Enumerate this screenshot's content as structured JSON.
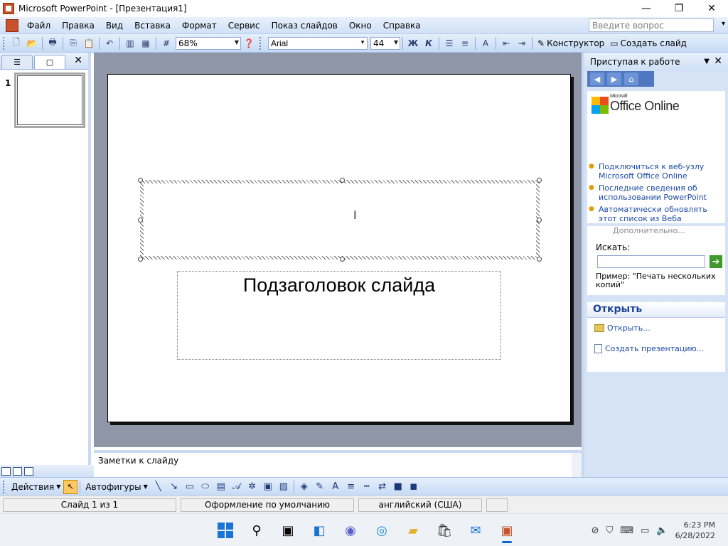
{
  "window": {
    "title": "Microsoft PowerPoint - [Презентация1]",
    "minimize": "—",
    "maximize": "❐",
    "close": "✕"
  },
  "menu": {
    "items": [
      "Файл",
      "Правка",
      "Вид",
      "Вставка",
      "Формат",
      "Сервис",
      "Показ слайдов",
      "Окно",
      "Справка"
    ],
    "help_placeholder": "Введите вопрос"
  },
  "toolbar": {
    "zoom": "68%",
    "font": "Arial",
    "font_size": "44",
    "bold_label": "Ж",
    "italic_label": "К",
    "designer_label": "Конструктор",
    "new_slide_label": "Создать слайд"
  },
  "left_pane": {
    "slide_number": "1"
  },
  "slide": {
    "subtitle_placeholder": "Подзаголовок слайда"
  },
  "notes": {
    "placeholder": "Заметки к слайду"
  },
  "task_pane": {
    "title": "Приступая к работе",
    "office_logo_small": "Microsoft",
    "office_logo_text": "Office Online",
    "links": [
      "Подключиться к веб-узлу Microsoft Office Online",
      "Последние сведения об использовании PowerPoint",
      "Автоматически обновлять этот список из Веба"
    ],
    "more": "Дополнительно...",
    "search_label": "Искать:",
    "example": "Пример: \"Печать нескольких копий\"",
    "open_section_title": "Открыть",
    "open_link": "Открыть...",
    "create_link": "Создать презентацию..."
  },
  "drawing": {
    "actions_label": "Действия",
    "autoshapes_label": "Автофигуры"
  },
  "status": {
    "slide_info": "Слайд 1 из 1",
    "design": "Оформление по умолчанию",
    "language": "английский (США)"
  },
  "taskbar": {
    "time": "6:23 PM",
    "date": "6/28/2022"
  },
  "colors": {
    "accent": "#1c4398",
    "link": "#1d4aa5",
    "selection": "#ffc864"
  }
}
